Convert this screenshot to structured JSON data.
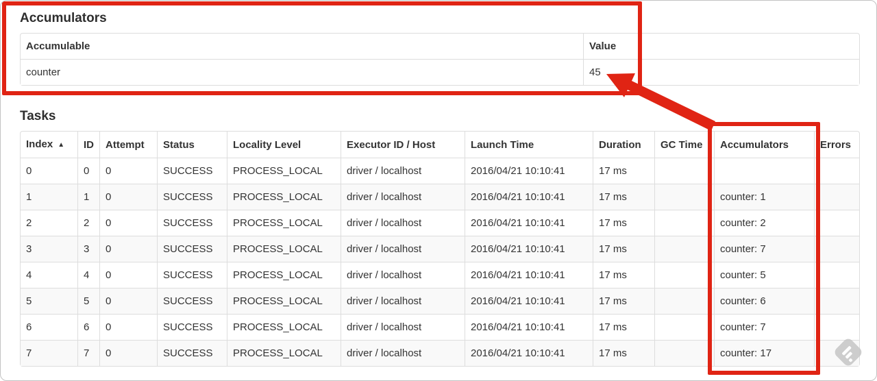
{
  "accumulators_section": {
    "title": "Accumulators",
    "table": {
      "headers": {
        "accumulable": "Accumulable",
        "value": "Value"
      },
      "rows": [
        {
          "accumulable": "counter",
          "value": "45"
        }
      ]
    }
  },
  "tasks_section": {
    "title": "Tasks",
    "table": {
      "headers": {
        "index": "Index",
        "id": "ID",
        "attempt": "Attempt",
        "status": "Status",
        "locality_level": "Locality Level",
        "executor": "Executor ID / Host",
        "launch_time": "Launch Time",
        "duration": "Duration",
        "gc_time": "GC Time",
        "accumulators": "Accumulators",
        "errors": "Errors"
      },
      "sort_indicator": "▲",
      "rows": [
        {
          "index": "0",
          "id": "0",
          "attempt": "0",
          "status": "SUCCESS",
          "locality_level": "PROCESS_LOCAL",
          "executor": "driver / localhost",
          "launch_time": "2016/04/21 10:10:41",
          "duration": "17 ms",
          "gc_time": "",
          "accumulators": "",
          "errors": ""
        },
        {
          "index": "1",
          "id": "1",
          "attempt": "0",
          "status": "SUCCESS",
          "locality_level": "PROCESS_LOCAL",
          "executor": "driver / localhost",
          "launch_time": "2016/04/21 10:10:41",
          "duration": "17 ms",
          "gc_time": "",
          "accumulators": "counter: 1",
          "errors": ""
        },
        {
          "index": "2",
          "id": "2",
          "attempt": "0",
          "status": "SUCCESS",
          "locality_level": "PROCESS_LOCAL",
          "executor": "driver / localhost",
          "launch_time": "2016/04/21 10:10:41",
          "duration": "17 ms",
          "gc_time": "",
          "accumulators": "counter: 2",
          "errors": ""
        },
        {
          "index": "3",
          "id": "3",
          "attempt": "0",
          "status": "SUCCESS",
          "locality_level": "PROCESS_LOCAL",
          "executor": "driver / localhost",
          "launch_time": "2016/04/21 10:10:41",
          "duration": "17 ms",
          "gc_time": "",
          "accumulators": "counter: 7",
          "errors": ""
        },
        {
          "index": "4",
          "id": "4",
          "attempt": "0",
          "status": "SUCCESS",
          "locality_level": "PROCESS_LOCAL",
          "executor": "driver / localhost",
          "launch_time": "2016/04/21 10:10:41",
          "duration": "17 ms",
          "gc_time": "",
          "accumulators": "counter: 5",
          "errors": ""
        },
        {
          "index": "5",
          "id": "5",
          "attempt": "0",
          "status": "SUCCESS",
          "locality_level": "PROCESS_LOCAL",
          "executor": "driver / localhost",
          "launch_time": "2016/04/21 10:10:41",
          "duration": "17 ms",
          "gc_time": "",
          "accumulators": "counter: 6",
          "errors": ""
        },
        {
          "index": "6",
          "id": "6",
          "attempt": "0",
          "status": "SUCCESS",
          "locality_level": "PROCESS_LOCAL",
          "executor": "driver / localhost",
          "launch_time": "2016/04/21 10:10:41",
          "duration": "17 ms",
          "gc_time": "",
          "accumulators": "counter: 7",
          "errors": ""
        },
        {
          "index": "7",
          "id": "7",
          "attempt": "0",
          "status": "SUCCESS",
          "locality_level": "PROCESS_LOCAL",
          "executor": "driver / localhost",
          "launch_time": "2016/04/21 10:10:41",
          "duration": "17 ms",
          "gc_time": "",
          "accumulators": "counter: 17",
          "errors": ""
        }
      ]
    }
  },
  "annotations": {
    "highlight_color": "#e02414",
    "watermark_color": "#c6c6c6",
    "arrow_target_value": "45"
  }
}
